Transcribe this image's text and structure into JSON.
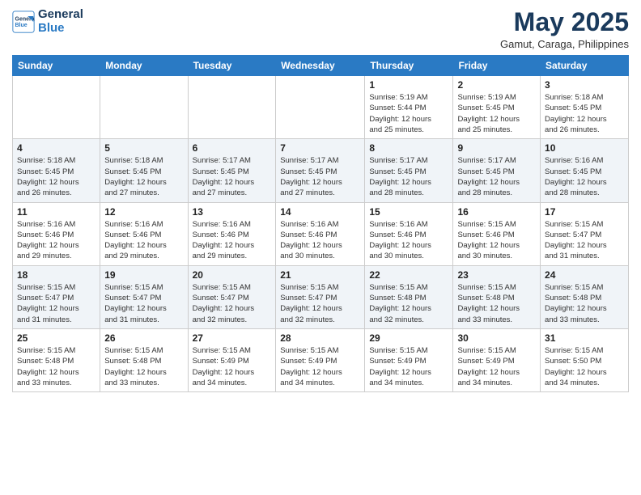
{
  "header": {
    "logo_line1": "General",
    "logo_line2": "Blue",
    "month_title": "May 2025",
    "location": "Gamut, Caraga, Philippines"
  },
  "days_of_week": [
    "Sunday",
    "Monday",
    "Tuesday",
    "Wednesday",
    "Thursday",
    "Friday",
    "Saturday"
  ],
  "weeks": [
    [
      {
        "day": "",
        "info": ""
      },
      {
        "day": "",
        "info": ""
      },
      {
        "day": "",
        "info": ""
      },
      {
        "day": "",
        "info": ""
      },
      {
        "day": "1",
        "info": "Sunrise: 5:19 AM\nSunset: 5:44 PM\nDaylight: 12 hours\nand 25 minutes."
      },
      {
        "day": "2",
        "info": "Sunrise: 5:19 AM\nSunset: 5:45 PM\nDaylight: 12 hours\nand 25 minutes."
      },
      {
        "day": "3",
        "info": "Sunrise: 5:18 AM\nSunset: 5:45 PM\nDaylight: 12 hours\nand 26 minutes."
      }
    ],
    [
      {
        "day": "4",
        "info": "Sunrise: 5:18 AM\nSunset: 5:45 PM\nDaylight: 12 hours\nand 26 minutes."
      },
      {
        "day": "5",
        "info": "Sunrise: 5:18 AM\nSunset: 5:45 PM\nDaylight: 12 hours\nand 27 minutes."
      },
      {
        "day": "6",
        "info": "Sunrise: 5:17 AM\nSunset: 5:45 PM\nDaylight: 12 hours\nand 27 minutes."
      },
      {
        "day": "7",
        "info": "Sunrise: 5:17 AM\nSunset: 5:45 PM\nDaylight: 12 hours\nand 27 minutes."
      },
      {
        "day": "8",
        "info": "Sunrise: 5:17 AM\nSunset: 5:45 PM\nDaylight: 12 hours\nand 28 minutes."
      },
      {
        "day": "9",
        "info": "Sunrise: 5:17 AM\nSunset: 5:45 PM\nDaylight: 12 hours\nand 28 minutes."
      },
      {
        "day": "10",
        "info": "Sunrise: 5:16 AM\nSunset: 5:45 PM\nDaylight: 12 hours\nand 28 minutes."
      }
    ],
    [
      {
        "day": "11",
        "info": "Sunrise: 5:16 AM\nSunset: 5:46 PM\nDaylight: 12 hours\nand 29 minutes."
      },
      {
        "day": "12",
        "info": "Sunrise: 5:16 AM\nSunset: 5:46 PM\nDaylight: 12 hours\nand 29 minutes."
      },
      {
        "day": "13",
        "info": "Sunrise: 5:16 AM\nSunset: 5:46 PM\nDaylight: 12 hours\nand 29 minutes."
      },
      {
        "day": "14",
        "info": "Sunrise: 5:16 AM\nSunset: 5:46 PM\nDaylight: 12 hours\nand 30 minutes."
      },
      {
        "day": "15",
        "info": "Sunrise: 5:16 AM\nSunset: 5:46 PM\nDaylight: 12 hours\nand 30 minutes."
      },
      {
        "day": "16",
        "info": "Sunrise: 5:15 AM\nSunset: 5:46 PM\nDaylight: 12 hours\nand 30 minutes."
      },
      {
        "day": "17",
        "info": "Sunrise: 5:15 AM\nSunset: 5:47 PM\nDaylight: 12 hours\nand 31 minutes."
      }
    ],
    [
      {
        "day": "18",
        "info": "Sunrise: 5:15 AM\nSunset: 5:47 PM\nDaylight: 12 hours\nand 31 minutes."
      },
      {
        "day": "19",
        "info": "Sunrise: 5:15 AM\nSunset: 5:47 PM\nDaylight: 12 hours\nand 31 minutes."
      },
      {
        "day": "20",
        "info": "Sunrise: 5:15 AM\nSunset: 5:47 PM\nDaylight: 12 hours\nand 32 minutes."
      },
      {
        "day": "21",
        "info": "Sunrise: 5:15 AM\nSunset: 5:47 PM\nDaylight: 12 hours\nand 32 minutes."
      },
      {
        "day": "22",
        "info": "Sunrise: 5:15 AM\nSunset: 5:48 PM\nDaylight: 12 hours\nand 32 minutes."
      },
      {
        "day": "23",
        "info": "Sunrise: 5:15 AM\nSunset: 5:48 PM\nDaylight: 12 hours\nand 33 minutes."
      },
      {
        "day": "24",
        "info": "Sunrise: 5:15 AM\nSunset: 5:48 PM\nDaylight: 12 hours\nand 33 minutes."
      }
    ],
    [
      {
        "day": "25",
        "info": "Sunrise: 5:15 AM\nSunset: 5:48 PM\nDaylight: 12 hours\nand 33 minutes."
      },
      {
        "day": "26",
        "info": "Sunrise: 5:15 AM\nSunset: 5:48 PM\nDaylight: 12 hours\nand 33 minutes."
      },
      {
        "day": "27",
        "info": "Sunrise: 5:15 AM\nSunset: 5:49 PM\nDaylight: 12 hours\nand 34 minutes."
      },
      {
        "day": "28",
        "info": "Sunrise: 5:15 AM\nSunset: 5:49 PM\nDaylight: 12 hours\nand 34 minutes."
      },
      {
        "day": "29",
        "info": "Sunrise: 5:15 AM\nSunset: 5:49 PM\nDaylight: 12 hours\nand 34 minutes."
      },
      {
        "day": "30",
        "info": "Sunrise: 5:15 AM\nSunset: 5:49 PM\nDaylight: 12 hours\nand 34 minutes."
      },
      {
        "day": "31",
        "info": "Sunrise: 5:15 AM\nSunset: 5:50 PM\nDaylight: 12 hours\nand 34 minutes."
      }
    ]
  ]
}
